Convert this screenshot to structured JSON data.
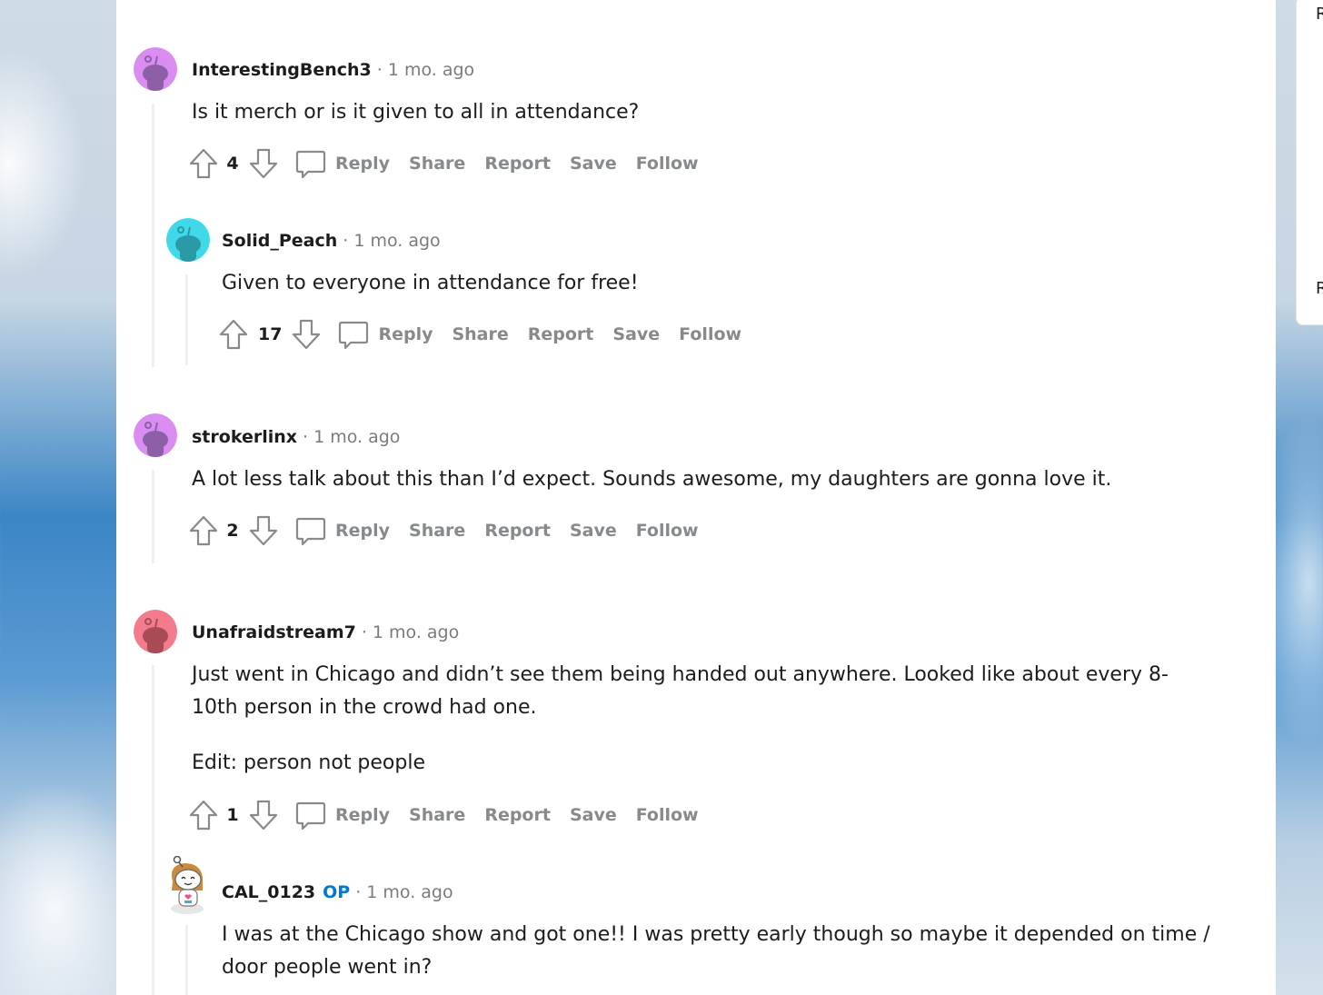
{
  "sidebar": {
    "letters": [
      "R",
      "R"
    ]
  },
  "comments": [
    {
      "author": "InterestingBench3",
      "separator": "·",
      "time": "1 mo. ago",
      "body": [
        "Is it merch or is it given to all in attendance?"
      ],
      "score": "4",
      "actions": {
        "reply": "Reply",
        "share": "Share",
        "report": "Report",
        "save": "Save",
        "follow": "Follow"
      },
      "avatar_color": "#d98df0"
    },
    {
      "author": "Solid_Peach",
      "separator": "·",
      "time": "1 mo. ago",
      "body": [
        "Given to everyone in attendance for free!"
      ],
      "score": "17",
      "actions": {
        "reply": "Reply",
        "share": "Share",
        "report": "Report",
        "save": "Save",
        "follow": "Follow"
      },
      "avatar_color": "#3fd9ea"
    },
    {
      "author": "strokerlinx",
      "separator": "·",
      "time": "1 mo. ago",
      "body": [
        "A lot less talk about this than I’d expect. Sounds awesome, my daughters are gonna love it."
      ],
      "score": "2",
      "actions": {
        "reply": "Reply",
        "share": "Share",
        "report": "Report",
        "save": "Save",
        "follow": "Follow"
      },
      "avatar_color": "#d98df0"
    },
    {
      "author": "Unafraidstream7",
      "separator": "·",
      "time": "1 mo. ago",
      "body": [
        "Just went in Chicago and didn’t see them being handed out anywhere. Looked like about every 8-10th person in the crowd had one.",
        "Edit: person not people"
      ],
      "score": "1",
      "actions": {
        "reply": "Reply",
        "share": "Share",
        "report": "Report",
        "save": "Save",
        "follow": "Follow"
      },
      "avatar_color": "#f27b8c"
    },
    {
      "author": "CAL_0123",
      "op_badge": "OP",
      "separator": "·",
      "time": "1 mo. ago",
      "body": [
        "I was at the Chicago show and got one!! I was pretty early though so maybe it depended on time / door people went in?"
      ]
    }
  ],
  "colors": {
    "username": "#1c1c1c",
    "meta": "#787c7e",
    "action": "#878a8c",
    "op": "#0079d3",
    "thread_line": "#edeff1"
  }
}
